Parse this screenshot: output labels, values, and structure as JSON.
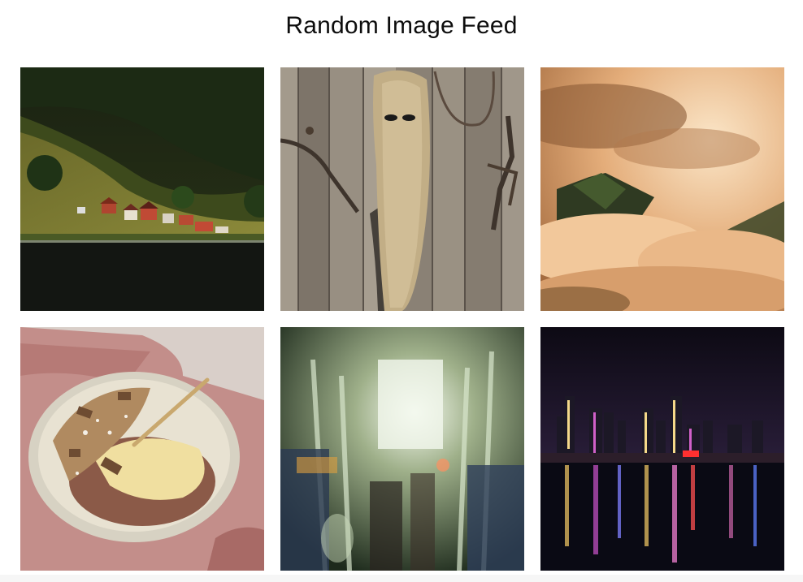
{
  "page": {
    "title": "Random Image Feed"
  },
  "feed": {
    "images": [
      {
        "subject": "fjord-village",
        "description": "Red houses on a green hillside above a dark fjord"
      },
      {
        "subject": "wooden-door-creature",
        "description": "Old wooden door with a furry creature shape and metal hinges"
      },
      {
        "subject": "clouds-mountain",
        "description": "Warm orange clouds surrounding a mountain peak"
      },
      {
        "subject": "granola-bowl",
        "description": "Bowl of granola with chocolate and pudding on pink cloth"
      },
      {
        "subject": "blurred-bus-interior",
        "description": "Motion-blurred interior of a bus with lights"
      },
      {
        "subject": "city-skyline-night",
        "description": "City skyline at night reflected in the harbor"
      }
    ]
  },
  "colors": {
    "background": "#ffffff",
    "title": "#0d0d0d"
  }
}
